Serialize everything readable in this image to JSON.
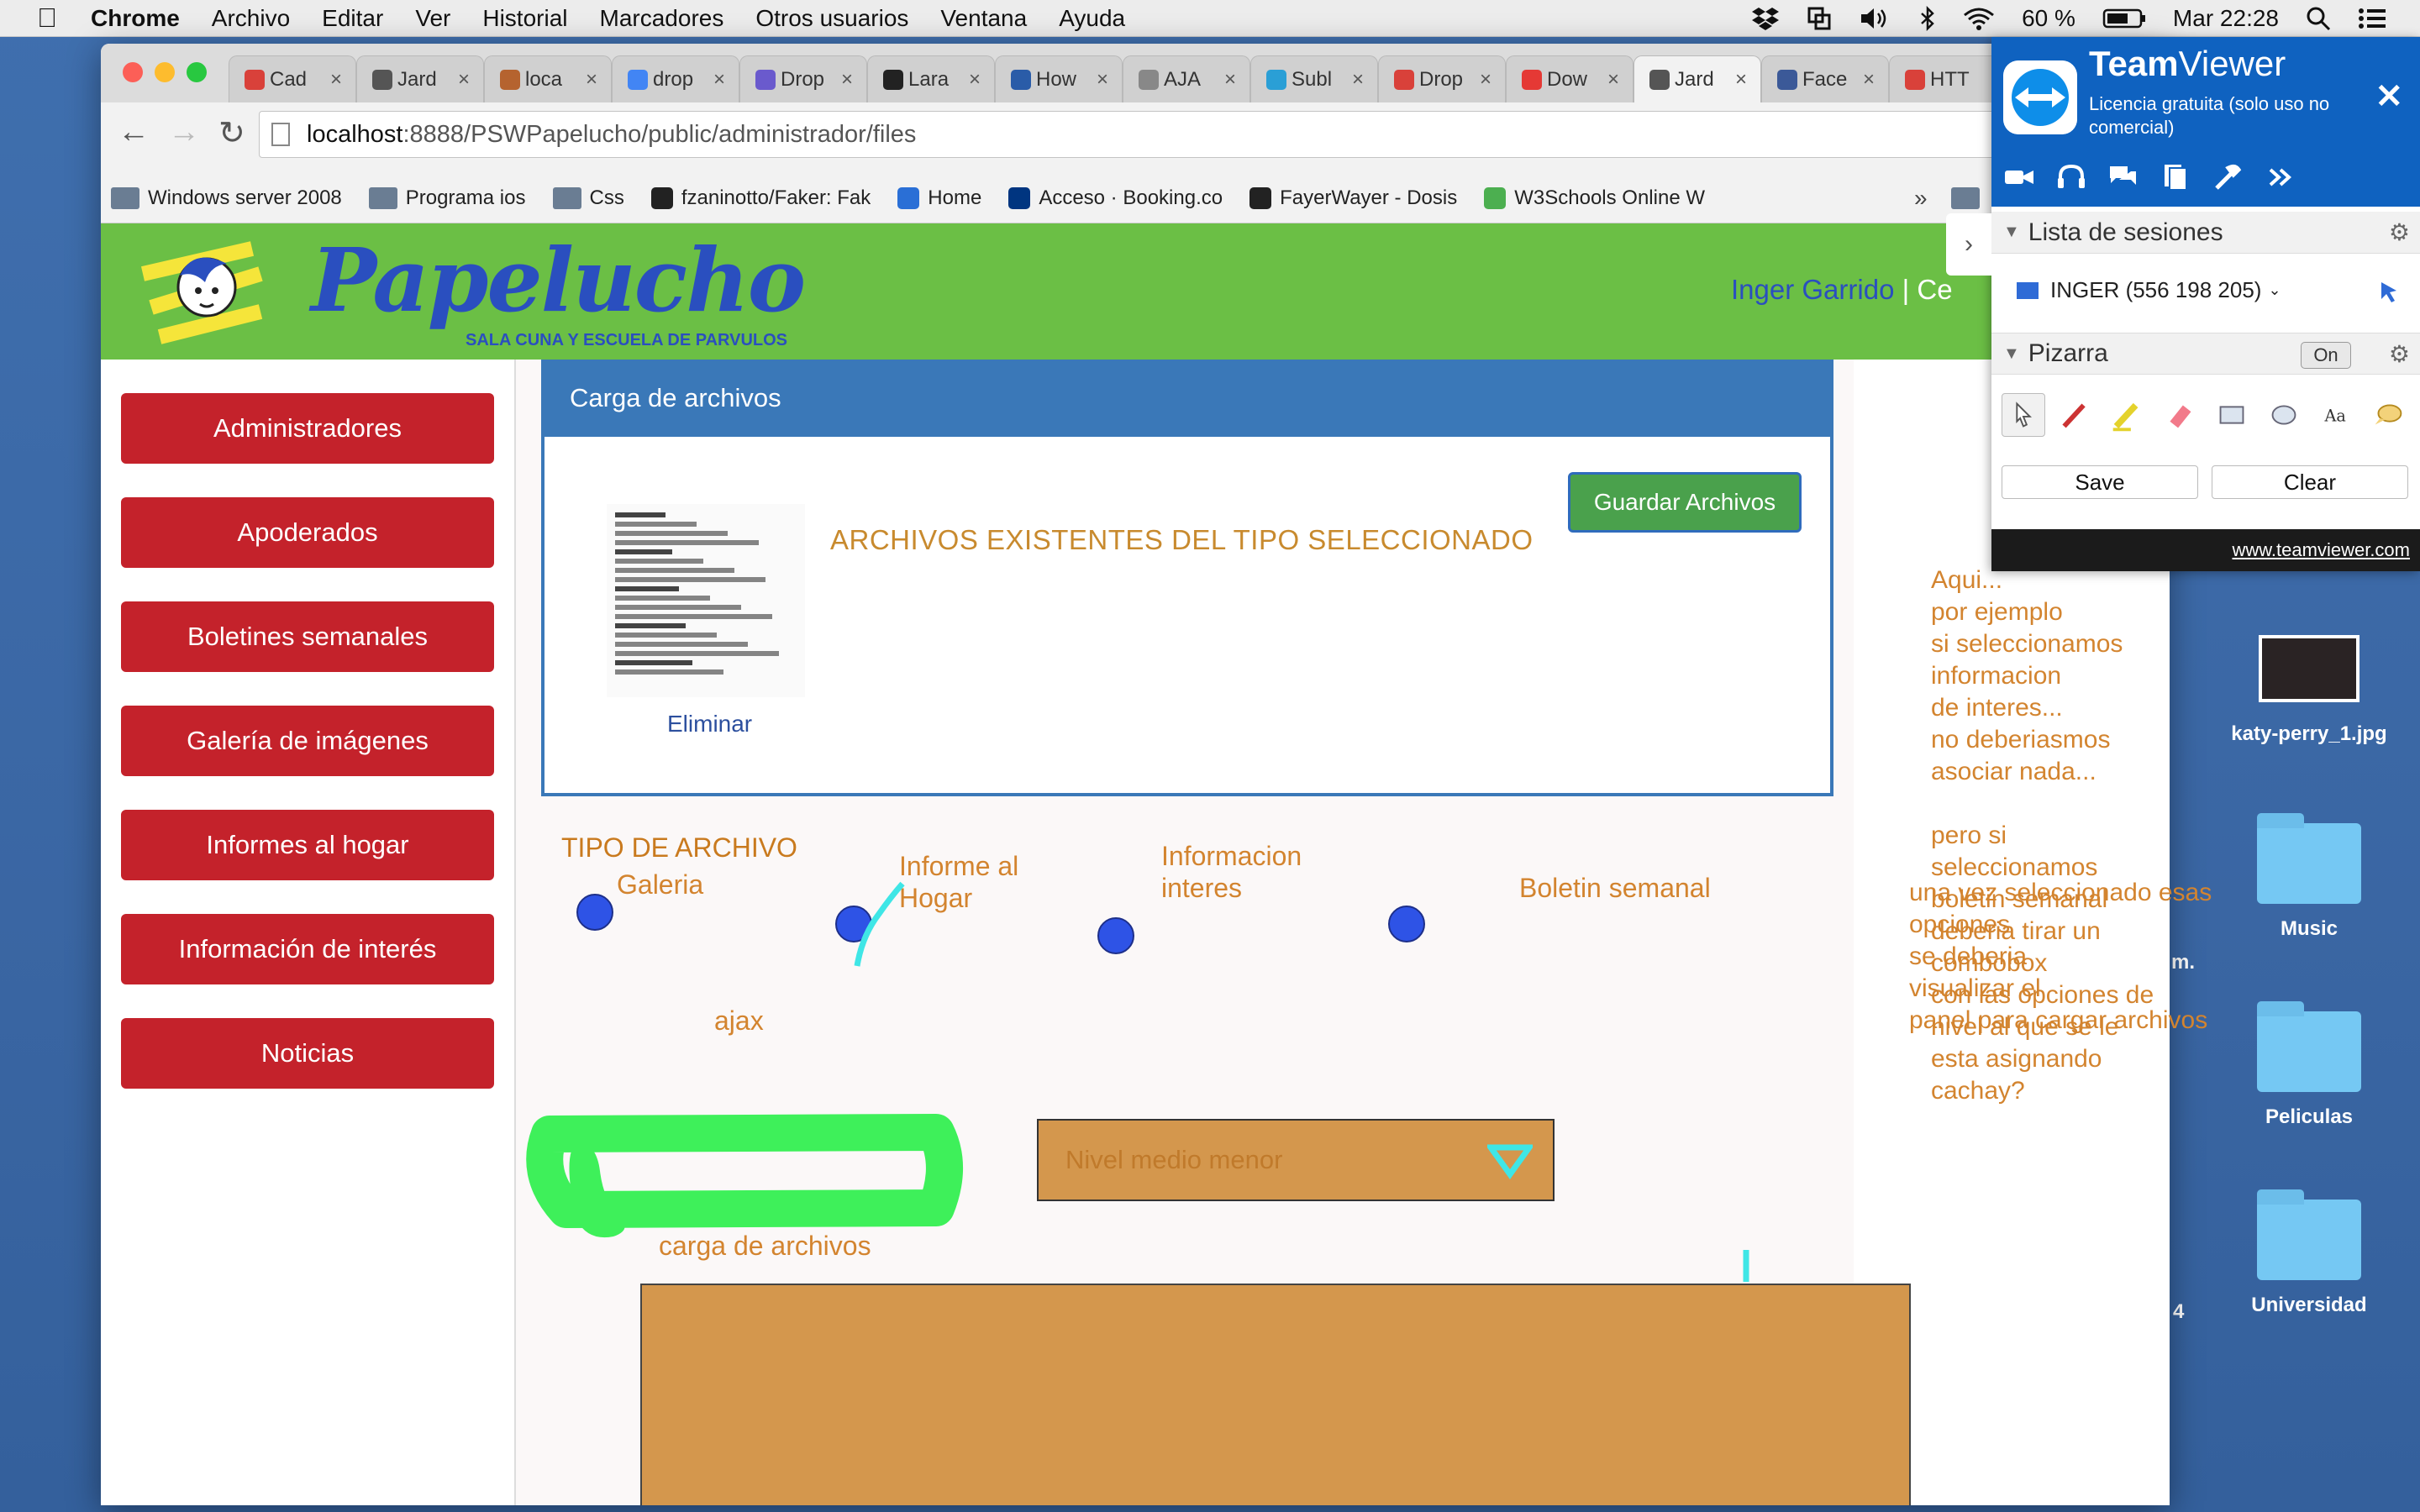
{
  "menubar": {
    "app": "Chrome",
    "items": [
      "Archivo",
      "Editar",
      "Ver",
      "Historial",
      "Marcadores",
      "Otros usuarios",
      "Ventana",
      "Ayuda"
    ],
    "battery": "60 %",
    "clock": "Mar 22:28"
  },
  "browser": {
    "tabs": [
      {
        "label": "Cad",
        "color": "#d9413a"
      },
      {
        "label": "Jard",
        "color": "#555555"
      },
      {
        "label": "loca",
        "color": "#b5632f"
      },
      {
        "label": "drop",
        "color": "#4285f4"
      },
      {
        "label": "Drop",
        "color": "#6a5acd"
      },
      {
        "label": "Lara",
        "color": "#222222"
      },
      {
        "label": "How",
        "color": "#2a5ca8"
      },
      {
        "label": "AJA",
        "color": "#888888"
      },
      {
        "label": "Subl",
        "color": "#2a9fd6"
      },
      {
        "label": "Drop",
        "color": "#d9413a"
      },
      {
        "label": "Dow",
        "color": "#e53935"
      },
      {
        "label": "Jard",
        "color": "#555555"
      },
      {
        "label": "Face",
        "color": "#3b5998"
      },
      {
        "label": "HTT",
        "color": "#d9413a"
      }
    ],
    "url_host": "localhost",
    "url_path": ":8888/PSWPapelucho/public/administrador/files",
    "bookmarks": [
      {
        "label": "Windows server 2008",
        "kind": "folder"
      },
      {
        "label": "Programa ios",
        "kind": "folder"
      },
      {
        "label": "Css",
        "kind": "folder"
      },
      {
        "label": "fzaninotto/Faker: Fak",
        "kind": "github"
      },
      {
        "label": "Home",
        "kind": "home"
      },
      {
        "label": "Acceso · Booking.co",
        "kind": "booking"
      },
      {
        "label": "FayerWayer - Dosis",
        "kind": "fw"
      },
      {
        "label": "W3Schools Online W",
        "kind": "w3"
      }
    ],
    "bookmarks_more": "»"
  },
  "site": {
    "logo": "Papelucho",
    "logo_sub": "SALA CUNA Y ESCUELA DE PARVULOS",
    "user": "Inger Garrido",
    "user_sep": " | ",
    "logout_partial": "Ce"
  },
  "sidebar": {
    "items": [
      "Administradores",
      "Apoderados",
      "Boletines semanales",
      "Galería de imágenes",
      "Informes al hogar",
      "Información de interés",
      "Noticias"
    ]
  },
  "panel": {
    "title": "Carga de archivos",
    "existing_title": "ARCHIVOS EXISTENTES DEL TIPO SELECCIONADO",
    "delete_label": "Eliminar",
    "save_button": "Guardar Archivos"
  },
  "form": {
    "tipo_label": "TIPO DE ARCHIVO",
    "options": [
      "Galeria",
      "Informe al Hogar",
      "Informacion interes",
      "Boletin semanal"
    ],
    "ajax_note": "ajax",
    "nivel_value": "Nivel medio menor",
    "upload_label": "carga de archivos"
  },
  "annotations": {
    "note1": [
      "Aqui...",
      "por ejemplo",
      "si seleccionamos informacion",
      "de interes...",
      "no deberiasmos",
      "asociar nada...",
      "",
      "pero si seleccionamos",
      "boletin semanal",
      "deberia tirar un combobox",
      "con las opciones de",
      "nivel al que se le esta asignando",
      "cachay?"
    ],
    "note2": [
      "una vez seleccionado esas",
      "opciones",
      "se deberia",
      "visualizar el",
      "panel para cargar archivos"
    ]
  },
  "teamviewer": {
    "brand_bold": "Team",
    "brand_rest": "Viewer",
    "license": "Licencia gratuita (solo uso no comercial)",
    "sessions_title": "Lista de sesiones",
    "session": "INGER (556 198 205)",
    "pizarra_title": "Pizarra",
    "pizarra_state": "On",
    "save": "Save",
    "clear": "Clear",
    "footer": "www.teamviewer.com"
  },
  "desktop": {
    "items": [
      "katy-perry_1.jpg",
      "Music",
      "Peliculas",
      "Universidad"
    ],
    "partial_m": "m.",
    "partial_4": "4"
  },
  "colors": {
    "header_green": "#6bbf45",
    "sidebar_red": "#c4222b",
    "panel_blue": "#3a78b8",
    "annotation_orange": "#d3842f",
    "drawing_green": "#3ef05a",
    "drawing_cyan": "#3fe6e6",
    "teamviewer_blue": "#0f62c0"
  }
}
